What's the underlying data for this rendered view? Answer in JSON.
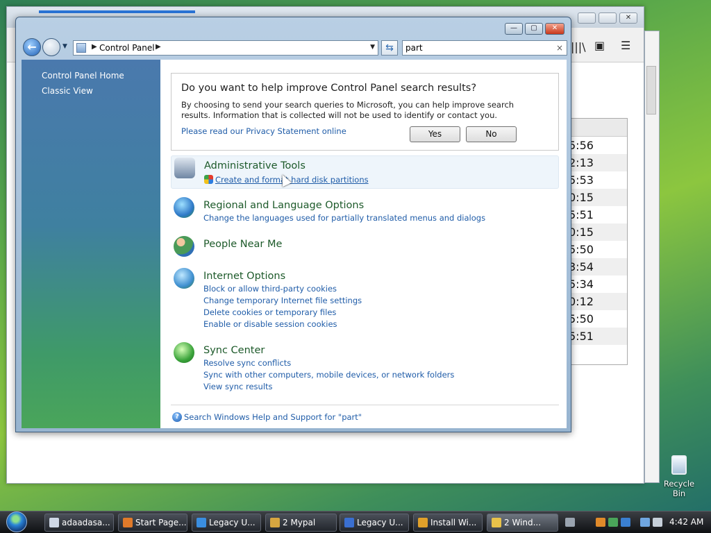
{
  "background_window": {
    "times": [
      "5:56",
      "2:13",
      "5:53",
      "0:15",
      "5:51",
      "0:15",
      "5:50",
      "3:54",
      "5:34",
      "0:12",
      "5:50",
      "5:51"
    ],
    "close_glyph": "✕"
  },
  "window": {
    "minimize": "—",
    "maximize": "▢",
    "close": "✕"
  },
  "address_bar": {
    "breadcrumb": "Control Panel"
  },
  "search": {
    "value": "part",
    "clear": "×"
  },
  "left_pane": {
    "links": [
      "Control Panel Home",
      "Classic View"
    ]
  },
  "prompt": {
    "title": "Do you want to help improve Control Panel search results?",
    "body": "By choosing to send your search queries to Microsoft, you can help improve search results. Information that is collected will not be used to identify or contact you.",
    "privacy_link": "Please read our Privacy Statement online",
    "yes": "Yes",
    "no": "No"
  },
  "results": [
    {
      "title": "Administrative Tools",
      "links": [
        "Create and format hard disk partitions"
      ],
      "icon": "admin-tools-icon",
      "color": "#6f86a3"
    },
    {
      "title": "Regional and Language Options",
      "links": [
        "Change the languages used for partially translated menus and dialogs"
      ],
      "icon": "globe-clock-icon",
      "color": "#2f79c8"
    },
    {
      "title": "People Near Me",
      "links": [],
      "icon": "people-icon",
      "color": "#4a9a58"
    },
    {
      "title": "Internet Options",
      "links": [
        "Block or allow third-party cookies",
        "Change temporary Internet file settings",
        "Delete cookies or temporary files",
        "Enable or disable session cookies"
      ],
      "icon": "internet-options-icon",
      "color": "#3f8fd0"
    },
    {
      "title": "Sync Center",
      "links": [
        "Resolve sync conflicts",
        "Sync with other computers, mobile devices, or network folders",
        "View sync results"
      ],
      "icon": "sync-center-icon",
      "color": "#3aa33a"
    }
  ],
  "help": {
    "text": "Search Windows Help and Support for \"part\""
  },
  "desktop": {
    "recycle_bin": "Recycle Bin"
  },
  "taskbar": {
    "buttons": [
      "adaadasa...",
      "Start Page...",
      "Legacy U...",
      "2 Mypal",
      "Legacy U...",
      "Install Wi...",
      "2 Wind..."
    ],
    "clock": "4:42 AM"
  }
}
